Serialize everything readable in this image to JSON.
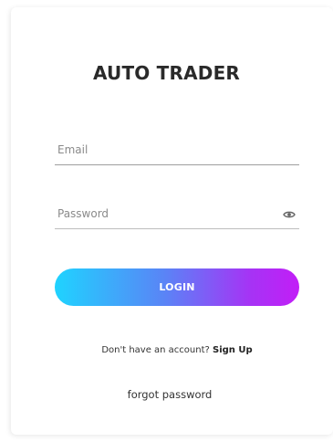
{
  "app": {
    "title": "AUTO TRADER"
  },
  "form": {
    "email": {
      "value": "",
      "placeholder": "Email"
    },
    "password": {
      "value": "",
      "placeholder": "Password"
    },
    "login_label": "LOGIN"
  },
  "signup": {
    "prompt": "Don't have an account?",
    "link_label": "Sign Up"
  },
  "forgot_label": "forgot password",
  "icons": {
    "password_toggle": "eye-icon"
  },
  "colors": {
    "gradient_start": "#1fd3ff",
    "gradient_end": "#c21ef7",
    "title": "#2a2a2a"
  }
}
